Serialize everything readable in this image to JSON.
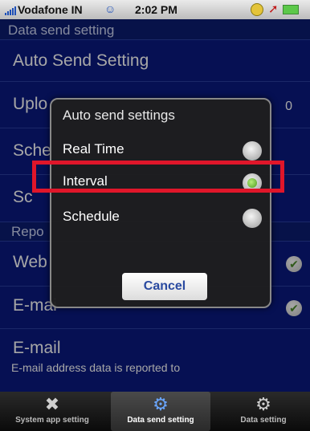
{
  "status_bar": {
    "carrier": "Vodafone IN",
    "time": "2:02 PM"
  },
  "header": {
    "title": "Data send setting"
  },
  "rows": {
    "auto_send": {
      "label": "Auto Send Setting"
    },
    "upload": {
      "label": "Uplo",
      "value": "0"
    },
    "schedule": {
      "label": "Sche"
    },
    "fourth": {
      "label": "Sc"
    }
  },
  "report_section": {
    "title": "Repo"
  },
  "report_rows": [
    {
      "label": "Web",
      "checked": true
    },
    {
      "label": "E-mai",
      "checked": true
    }
  ],
  "email_row": {
    "label": "E-mail",
    "description": "E-mail address data is reported to"
  },
  "dialog": {
    "title": "Auto send settings",
    "options": [
      {
        "label": "Real Time",
        "selected": false
      },
      {
        "label": "Interval",
        "selected": true
      },
      {
        "label": "Schedule",
        "selected": false
      }
    ],
    "cancel_label": "Cancel",
    "highlight_color": "#e0162a"
  },
  "tabbar": {
    "tabs": [
      {
        "label": "System app setting",
        "icon": "tools-icon",
        "active": false
      },
      {
        "label": "Data send setting",
        "icon": "gears-icon",
        "active": true
      },
      {
        "label": "Data setting",
        "icon": "gear-icon",
        "active": false
      }
    ]
  },
  "colors": {
    "background": "#0a1a78",
    "accent": "#e0162a"
  }
}
